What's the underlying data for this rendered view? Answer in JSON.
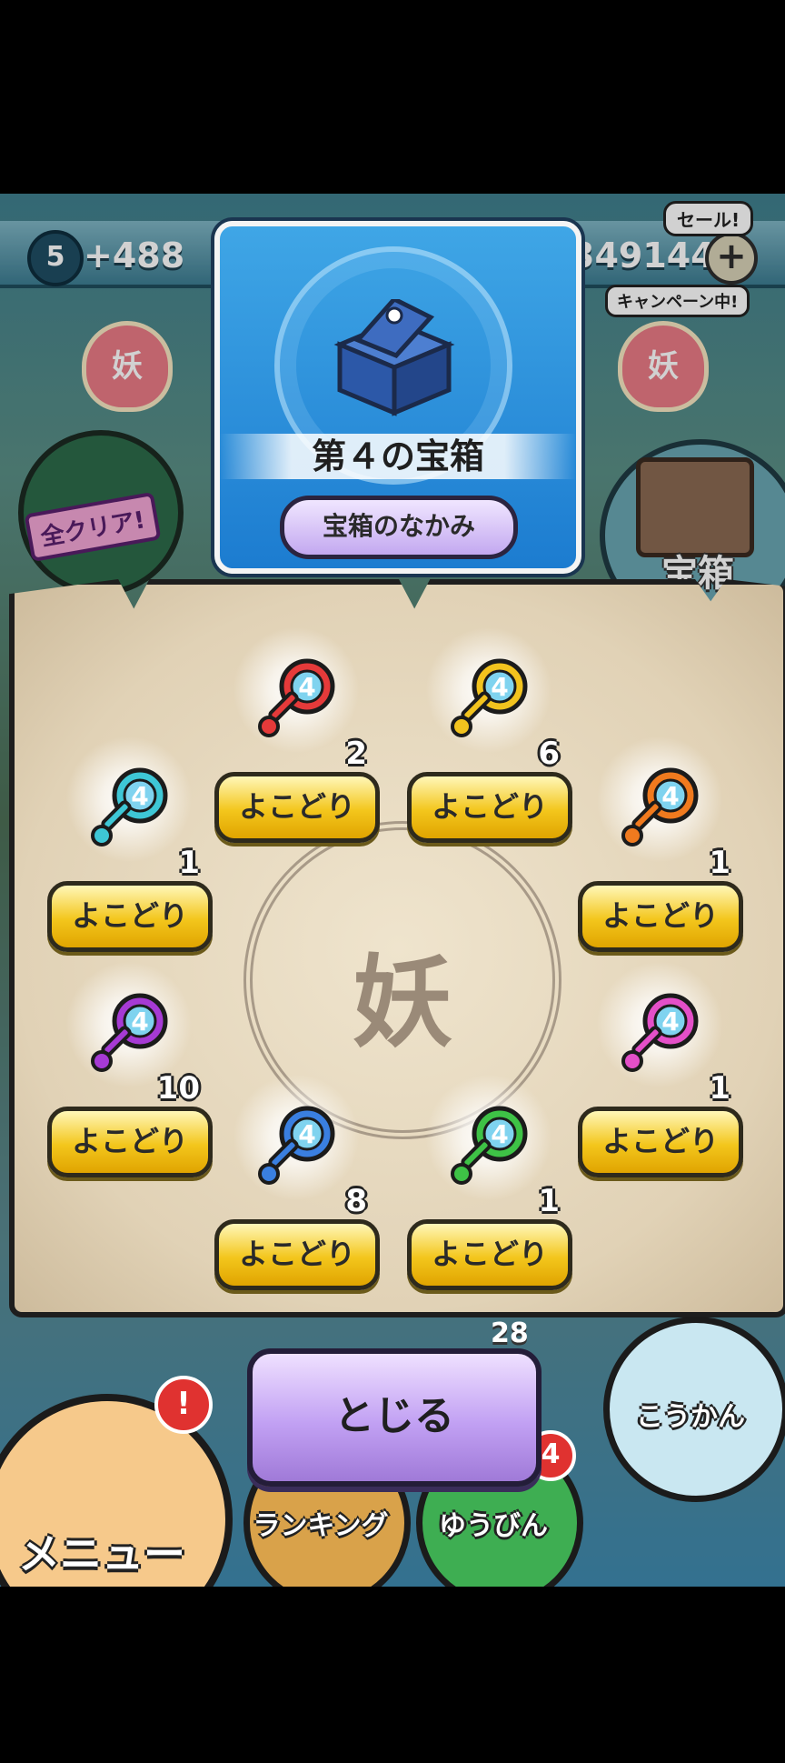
{
  "status": {
    "level": "5",
    "points": "+488",
    "money": "349144",
    "sale_badge": "セール!",
    "campaign_badge": "キャンペーン中!",
    "yokai_badge": "妖"
  },
  "side": {
    "allclear_label": "全クリア!",
    "chest_label": "宝箱"
  },
  "header": {
    "title": "第４の宝箱",
    "contents_button": "宝箱のなかみ"
  },
  "rewards": [
    {
      "key_color": "#e53a3a",
      "count": "2",
      "button": "よこどり"
    },
    {
      "key_color": "#f2c31e",
      "count": "6",
      "button": "よこどり"
    },
    {
      "key_color": "#3ec7d6",
      "count": "1",
      "button": "よこどり"
    },
    {
      "key_color": "#f07a1e",
      "count": "1",
      "button": "よこどり"
    },
    {
      "key_color": "#a63ad4",
      "count": "10",
      "button": "よこどり"
    },
    {
      "key_color": "#e44fc8",
      "count": "1",
      "button": "よこどり"
    },
    {
      "key_color": "#3a7fe0",
      "count": "8",
      "button": "よこどり"
    },
    {
      "key_color": "#3ec246",
      "count": "1",
      "button": "よこどり"
    }
  ],
  "emblem_mark": "妖",
  "bottom": {
    "close_button": "とじる",
    "stage_count": "28",
    "menu_label": "メニュー",
    "menu_alert": "!",
    "ranking_label": "ランキング",
    "mail_label": "ゆうびん",
    "mail_badge": "4",
    "exchange_label": "こうかん"
  },
  "colors": {
    "accent_blue": "#1c7cd0",
    "button_yellow": "#f3c61c",
    "button_purple": "#c1a0f3"
  }
}
